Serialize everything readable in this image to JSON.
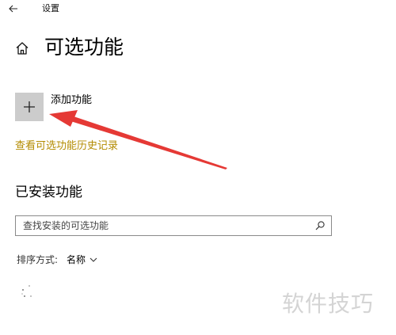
{
  "window": {
    "title": "设置"
  },
  "page": {
    "title": "可选功能"
  },
  "add_feature": {
    "label": "添加功能"
  },
  "history_link": {
    "label": "查看可选功能历史记录"
  },
  "installed_section": {
    "heading": "已安装功能",
    "search": {
      "placeholder": "查找安装的可选功能",
      "value": ""
    },
    "sort": {
      "label": "排序方式:",
      "selected": "名称"
    }
  },
  "watermark": {
    "text": "软件技巧"
  },
  "icons": {
    "back": "back-arrow-icon",
    "home": "home-icon",
    "add": "plus-icon",
    "search": "search-icon",
    "dropdown": "chevron-down-icon",
    "loading": "loading-dots-icon"
  },
  "colors": {
    "accent_link": "#b38b00",
    "add_tile_bg": "#cccccc",
    "annotation_arrow": "#e53935",
    "watermark": "#d4d4d4"
  }
}
